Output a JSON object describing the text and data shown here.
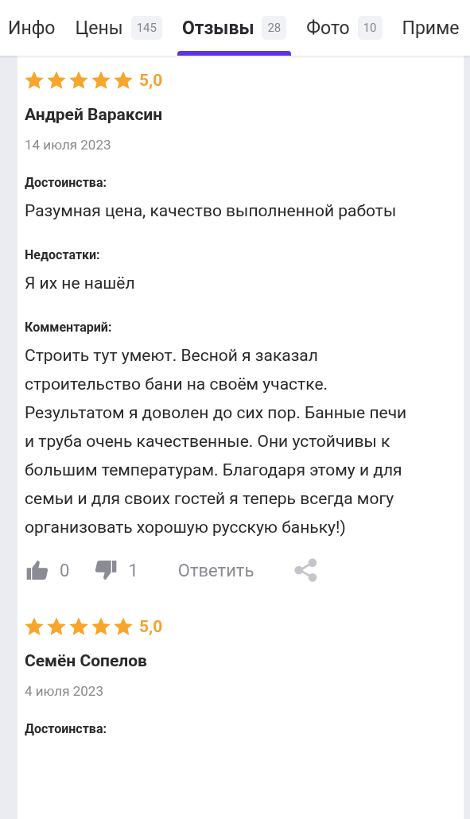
{
  "tabs": [
    {
      "label": "Инфо",
      "selected": false
    },
    {
      "label": "Цены",
      "count": "145",
      "selected": false
    },
    {
      "label": "Отзывы",
      "count": "28",
      "selected": true
    },
    {
      "label": "Фото",
      "count": "10",
      "selected": false
    },
    {
      "label": "Приме",
      "selected": false
    }
  ],
  "reviews": [
    {
      "stars": 5,
      "rating": "5,0",
      "author": "Андрей Вараксин",
      "date": "14 июля 2023",
      "sections": [
        {
          "label": "Достоинства:",
          "text": "Разумная цена, качество выполненной работы"
        },
        {
          "label": "Недостатки:",
          "text": "Я их не нашёл"
        },
        {
          "label": "Комментарий:",
          "text": "Строить тут умеют. Весной я заказал строительство бани на своём участке. Результатом я доволен до сих пор. Банные печи и труба очень качественные. Они устойчивы к большим температурам. Благодаря этому и для семьи и для своих гостей я теперь всегда могу организовать хорошую русскую баньку!)"
        }
      ],
      "likes": "0",
      "dislikes": "1",
      "reply": "Ответить"
    },
    {
      "stars": 5,
      "rating": "5,0",
      "author": "Семён Сопелов",
      "date": "4 июля 2023",
      "sections": [
        {
          "label": "Достоинства:"
        }
      ]
    }
  ]
}
